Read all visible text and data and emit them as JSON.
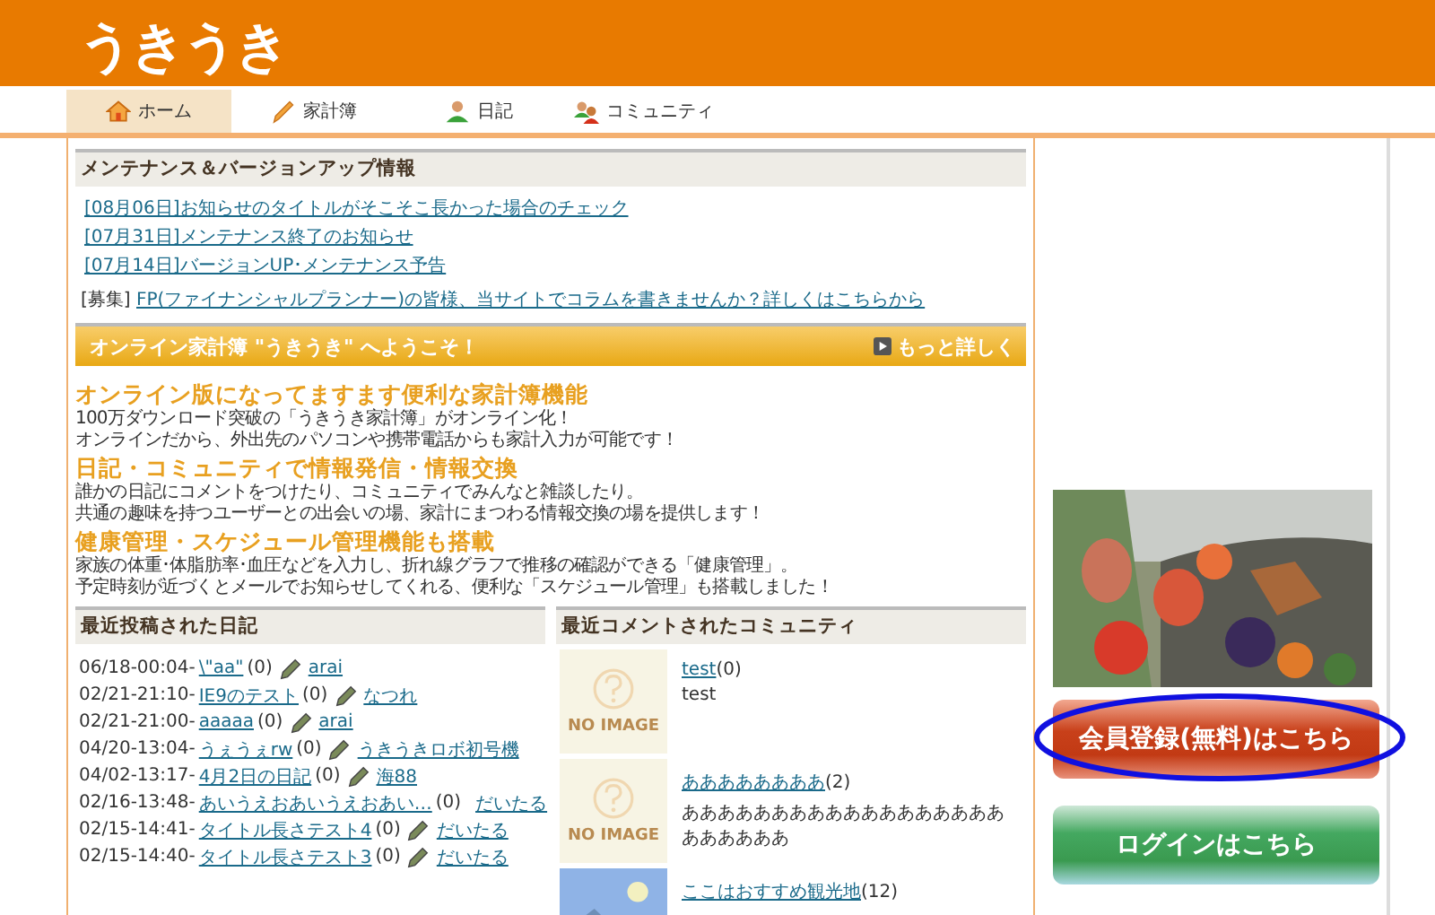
{
  "logo": "うきうき",
  "nav": [
    {
      "label": "ホーム",
      "selected": true
    },
    {
      "label": "家計簿",
      "selected": false
    },
    {
      "label": "日記",
      "selected": false
    },
    {
      "label": "コミュニティ",
      "selected": false
    }
  ],
  "notices": {
    "title": "メンテナンス＆バージョンアップ情報",
    "items": [
      "[08月06日]お知らせのタイトルがそこそこ長かった場合のチェック",
      "[07月31日]メンテナンス終了のお知らせ",
      "[07月14日]バージョンUP･メンテナンス予告"
    ],
    "recruit": {
      "tag": "[募集]",
      "link": "FP(ファイナンシャルプランナー)の皆様、当サイトでコラムを書きませんか？詳しくはこちらから"
    }
  },
  "welcome": {
    "title": "オンライン家計簿 \"うきうき\" へようこそ！",
    "more": "もっと詳しく"
  },
  "features": [
    {
      "heading": "オンライン版になってますます便利な家計簿機能",
      "lines": [
        "100万ダウンロード突破の「うきうき家計簿」がオンライン化！",
        "オンラインだから、外出先のパソコンや携帯電話からも家計入力が可能です！"
      ]
    },
    {
      "heading": "日記・コミュニティで情報発信・情報交換",
      "lines": [
        "誰かの日記にコメントをつけたり、コミュニティでみんなと雑談したり。",
        "共通の趣味を持つユーザーとの出会いの場、家計にまつわる情報交換の場を提供します！"
      ]
    },
    {
      "heading": "健康管理・スケジュール管理機能も搭載",
      "lines": [
        "家族の体重･体脂肪率･血圧などを入力し、折れ線グラフで推移の確認ができる「健康管理」。",
        "予定時刻が近づくとメールでお知らせしてくれる、便利な「スケジュール管理」も搭載しました！"
      ]
    }
  ],
  "diaries": {
    "title": "最近投稿された日記",
    "rows": [
      {
        "time": "06/18-00:04-",
        "title": "\\\"aa\"",
        "count": "(0)",
        "author": "arai"
      },
      {
        "time": "02/21-21:10-",
        "title": "IE9のテスト",
        "count": "(0)",
        "author": "なつれ"
      },
      {
        "time": "02/21-21:00-",
        "title": "aaaaa",
        "count": "(0)",
        "author": "arai"
      },
      {
        "time": "04/20-13:04-",
        "title": "うぇうぇrw",
        "count": "(0)",
        "author": "うきうきロボ初号機"
      },
      {
        "time": "04/02-13:17-",
        "title": "4月2日の日記",
        "count": "(0)",
        "author": "海88"
      },
      {
        "time": "02/16-13:48-",
        "title": "あいうえおあいうえおあい…",
        "count": "(0)",
        "author": "だいたる"
      },
      {
        "time": "02/15-14:41-",
        "title": "タイトル長さテスト4",
        "count": "(0)",
        "author": "だいたる"
      },
      {
        "time": "02/15-14:40-",
        "title": "タイトル長さテスト3",
        "count": "(0)",
        "author": "だいたる"
      }
    ]
  },
  "communities": {
    "title": "最近コメントされたコミュニティ",
    "items": [
      {
        "kind": "noimage",
        "image_text": "NO IMAGE",
        "name": "test",
        "count": "(0)",
        "description": "test"
      },
      {
        "kind": "noimage",
        "image_text": "NO IMAGE",
        "name": "ああああああああ",
        "count": "(2)",
        "description": "ああああああああああああああああああああああああ"
      },
      {
        "kind": "picture",
        "name": "ここはおすすめ観光地",
        "count": "(12)"
      }
    ]
  },
  "side": {
    "register": {
      "label": "会員登録(無料)はこちら",
      "circled": true
    },
    "login": "ログインはこちら"
  }
}
